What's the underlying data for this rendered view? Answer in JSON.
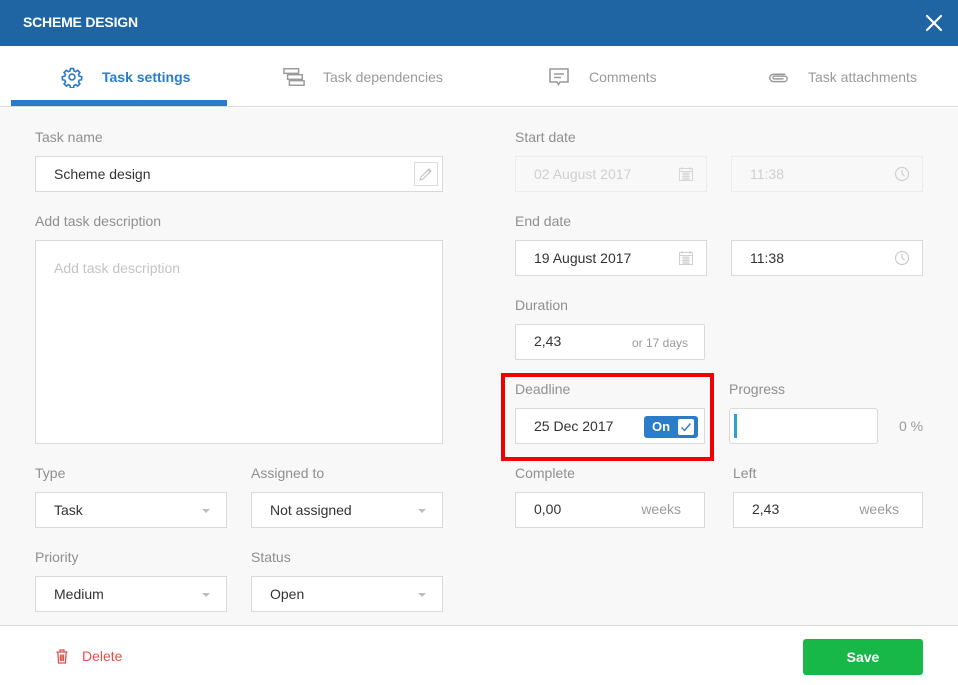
{
  "header": {
    "title": "SCHEME DESIGN",
    "close_icon": "close-icon"
  },
  "tabs": [
    {
      "label": "Task settings",
      "icon": "gear-icon",
      "active": true
    },
    {
      "label": "Task dependencies",
      "icon": "dependencies-icon",
      "active": false
    },
    {
      "label": "Comments",
      "icon": "comment-icon",
      "active": false
    },
    {
      "label": "Task attachments",
      "icon": "paperclip-icon",
      "active": false
    }
  ],
  "form": {
    "task_name": {
      "label": "Task name",
      "value": "Scheme design"
    },
    "description": {
      "label": "Add task description",
      "placeholder": "Add task description"
    },
    "type": {
      "label": "Type",
      "value": "Task"
    },
    "assigned_to": {
      "label": "Assigned to",
      "value": "Not assigned"
    },
    "priority": {
      "label": "Priority",
      "value": "Medium"
    },
    "status": {
      "label": "Status",
      "value": "Open"
    },
    "start_date": {
      "label": "Start date",
      "date": "02 August 2017",
      "time": "11:38",
      "disabled": true
    },
    "end_date": {
      "label": "End date",
      "date": "19 August 2017",
      "time": "11:38"
    },
    "duration": {
      "label": "Duration",
      "value": "2,43",
      "suffix": "or 17 days"
    },
    "deadline": {
      "label": "Deadline",
      "value": "25 Dec 2017",
      "toggle_label": "On",
      "toggle_on": true
    },
    "progress": {
      "label": "Progress",
      "percent": 0,
      "text": "0 %"
    },
    "complete": {
      "label": "Complete",
      "value": "0,00",
      "unit": "weeks"
    },
    "left": {
      "label": "Left",
      "value": "2,43",
      "unit": "weeks"
    }
  },
  "footer": {
    "delete_label": "Delete",
    "save_label": "Save"
  },
  "colors": {
    "header": "#1f65a3",
    "accent": "#2b7cc9",
    "save": "#17b847",
    "delete": "#e0514b",
    "highlight": "#f20000"
  }
}
